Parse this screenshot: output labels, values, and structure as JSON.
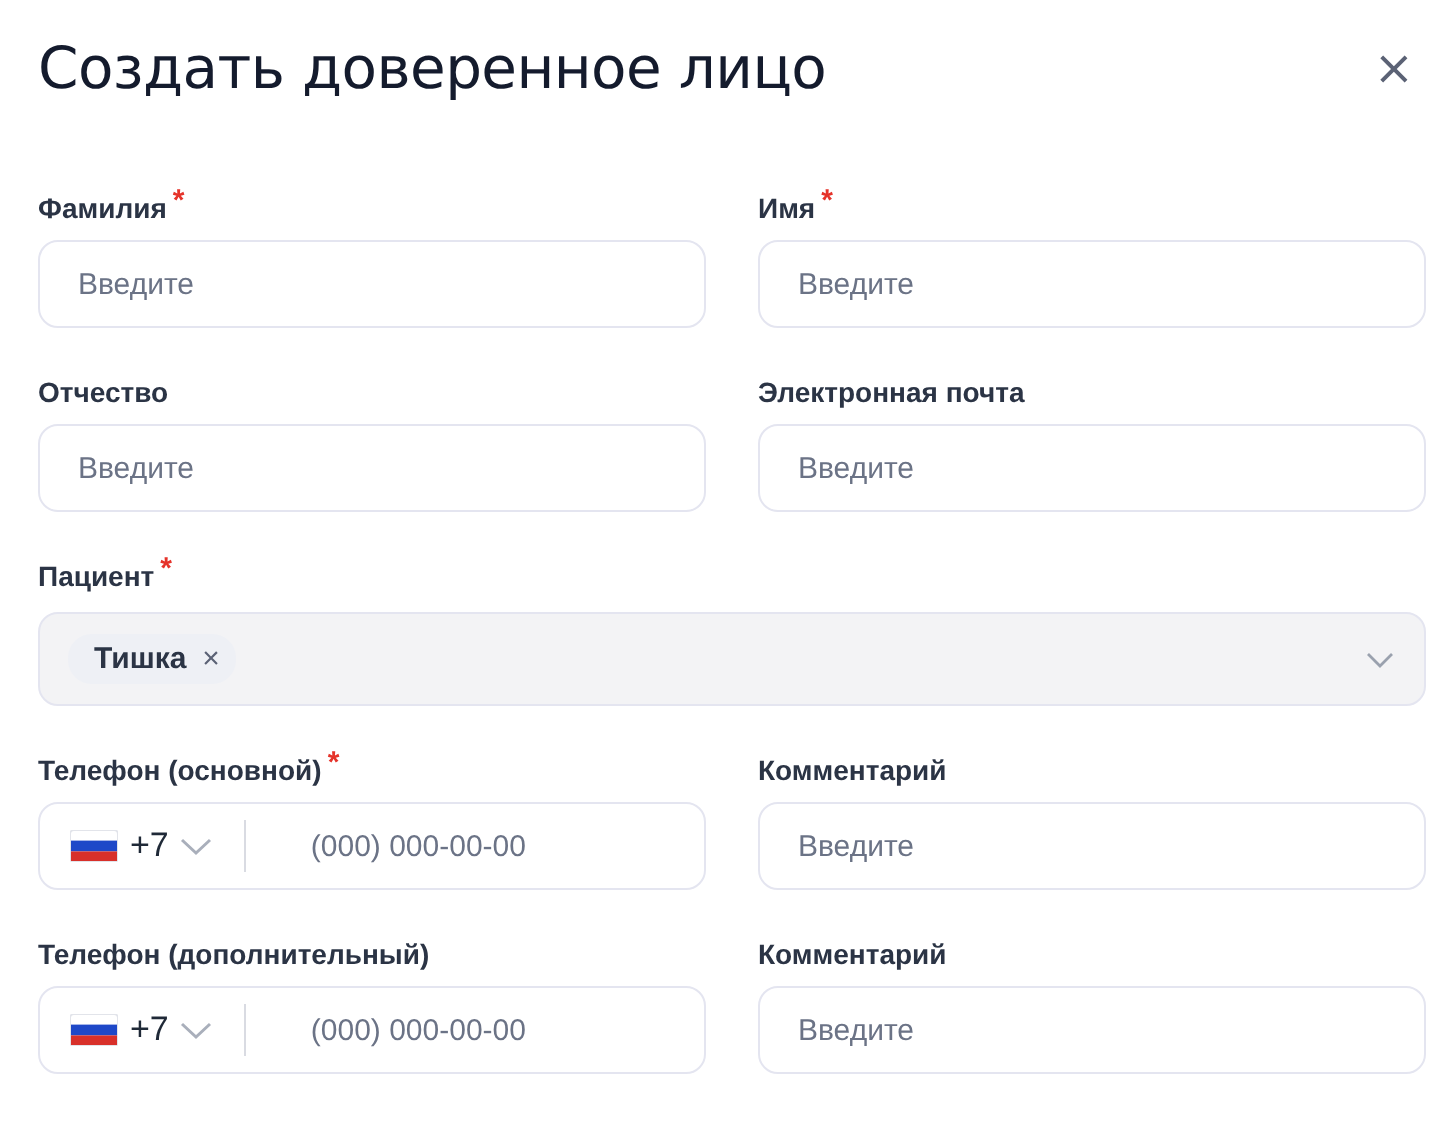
{
  "title": "Создать доверенное лицо",
  "close": "×",
  "rows": [
    {
      "fields": [
        {
          "kind": "text",
          "label": "Фамилия",
          "required_mark": "*",
          "placeholder": "Введите"
        },
        {
          "kind": "text",
          "label": "Имя",
          "required_mark": "*",
          "placeholder": "Введите"
        }
      ]
    },
    {
      "fields": [
        {
          "kind": "text",
          "label": "Отчество",
          "placeholder": "Введите"
        },
        {
          "kind": "text",
          "label": "Электронная почта",
          "placeholder": "Введите"
        }
      ]
    },
    {
      "fields": [
        {
          "kind": "select",
          "label": "Пациент",
          "required_mark": "*",
          "disabled": true,
          "tags": [
            {
              "label": "Тишка",
              "remove": "×"
            }
          ]
        }
      ]
    },
    {
      "fields": [
        {
          "kind": "phone",
          "label": "Телефон (основной)",
          "required_mark": "*",
          "code": "+7",
          "placeholder": "(000) 000-00-00"
        },
        {
          "kind": "text",
          "label": "Комментарий",
          "placeholder": "Введите"
        }
      ]
    },
    {
      "fields": [
        {
          "kind": "phone",
          "label": "Телефон (дополнительный)",
          "code": "+7",
          "placeholder": "(000) 000-00-00"
        },
        {
          "kind": "text",
          "label": "Комментарий",
          "placeholder": "Введите"
        }
      ]
    }
  ]
}
